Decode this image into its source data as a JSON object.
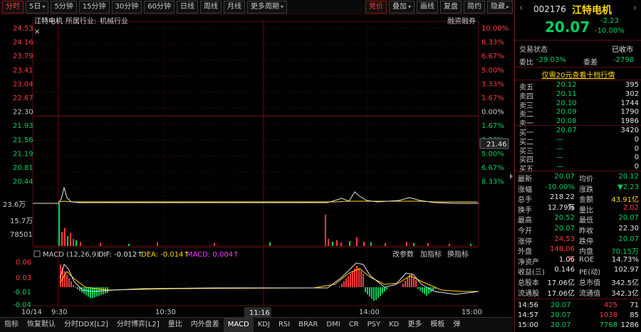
{
  "toolbar": {
    "periods": [
      "分时",
      "5日",
      "5分钟",
      "15分钟",
      "30分钟",
      "60分钟",
      "日线",
      "周线",
      "月线",
      "更多周期"
    ],
    "right_buttons": [
      "竞价",
      "叠加",
      "画线",
      "复盘",
      "简约",
      "隐藏"
    ],
    "prev_icon": "chevron-left-icon",
    "next_icon": "chevron-right-icon"
  },
  "chart": {
    "stock_label": "江特电机",
    "industry_label": "所属行业:",
    "industry_value": "机械行业",
    "margin_label": "融资融券",
    "price_ticks": [
      "24.53",
      "24.16",
      "23.79",
      "23.41",
      "23.04",
      "22.67",
      "22.30",
      "21.93",
      "21.56",
      "21.19",
      "20.81",
      "20.44"
    ],
    "pct_ticks": [
      "10.00%",
      "8.33%",
      "6.67%",
      "5.00%",
      "3.33%",
      "1.67%",
      "0.00%",
      "1.67%",
      "3.33%",
      "5.00%",
      "6.67%",
      "8.33%"
    ],
    "current_tag": "21.46",
    "vol_ticks": [
      "23.6万",
      "15.7万",
      "78501"
    ],
    "macd_title": "MACD (12,26,9)",
    "dif": "DIF: -0.012↑",
    "dea": "DEA: -0.014↑",
    "macd": "MACD: 0.004↑",
    "macd_buttons": [
      "改参数",
      "加指标",
      "换指标"
    ],
    "macd_ticks": [
      "0.06",
      "0.03",
      "-0.01",
      "-0.04"
    ],
    "time_ticks": [
      "10/14",
      "9:30",
      "10:30",
      "11:16",
      "14:00",
      "15:00"
    ],
    "colors": {
      "up": "#ff3b3b",
      "down": "#00d060",
      "price_line": "#e6e6e6",
      "avg_line": "#ffd700",
      "dea_line": "#ffd700"
    }
  },
  "tabs": [
    "指标",
    "恢复默认",
    "分时DDX[L2]",
    "分时博弈[L2]",
    "量比",
    "内外盘差",
    "MACD",
    "KDJ",
    "RSI",
    "BRAR",
    "DMI",
    "CR",
    "PSY",
    "KD",
    "更多",
    "模板",
    "弹"
  ],
  "panel": {
    "code": "002176",
    "name": "江特电机",
    "price": "20.07",
    "change": "-2.23",
    "change_pct": "-10.00%",
    "status_label": "交易状态",
    "status_value": "已收市",
    "weibi_label": "委比",
    "weibi_value": "-29.03%",
    "weicha_label": "委差",
    "weicha_value": "-2798",
    "promo": "仅需20元查看十档行情",
    "asks": [
      {
        "label": "卖五",
        "price": "20.12",
        "vol": "395"
      },
      {
        "label": "卖四",
        "price": "20.11",
        "vol": "302"
      },
      {
        "label": "卖三",
        "price": "20.10",
        "vol": "1744"
      },
      {
        "label": "卖二",
        "price": "20.09",
        "vol": "1790"
      },
      {
        "label": "卖一",
        "price": "20.08",
        "vol": "1986"
      }
    ],
    "bids": [
      {
        "label": "买一",
        "price": "20.07",
        "vol": "3420"
      },
      {
        "label": "买二",
        "price": "—",
        "vol": "0"
      },
      {
        "label": "买三",
        "price": "—",
        "vol": "0"
      },
      {
        "label": "买四",
        "price": "—",
        "vol": "0"
      },
      {
        "label": "买五",
        "price": "—",
        "vol": "0"
      }
    ],
    "stats": [
      {
        "l1": "最新",
        "v1": "20.07",
        "c1": "green",
        "l2": "均价",
        "v2": "20.12",
        "c2": "green"
      },
      {
        "l1": "涨幅",
        "v1": "-10.00%",
        "c1": "green",
        "l2": "涨跌",
        "v2": "▼2.23",
        "c2": "green"
      },
      {
        "l1": "总手",
        "v1": "218.22万",
        "c1": "white",
        "l2": "金额",
        "v2": "43.91亿",
        "c2": "yellow"
      },
      {
        "l1": "换手",
        "v1": "12.79%",
        "c1": "white",
        "l2": "量比",
        "v2": "2.02",
        "c2": "red"
      },
      {
        "l1": "最高",
        "v1": "20.52",
        "c1": "green",
        "l2": "最低",
        "v2": "20.07",
        "c2": "green"
      },
      {
        "l1": "今开",
        "v1": "20.07",
        "c1": "green",
        "l2": "昨收",
        "v2": "22.30",
        "c2": "white"
      },
      {
        "l1": "涨停",
        "v1": "24.53",
        "c1": "red",
        "l2": "跌停",
        "v2": "20.07",
        "c2": "green"
      },
      {
        "l1": "外盘",
        "v1": "148.06万",
        "c1": "red",
        "l2": "内盘",
        "v2": "70.15万",
        "c2": "green"
      },
      {
        "l1": "净资产",
        "v1": "1.06",
        "c1": "white",
        "l2": "ROE",
        "v2": "14.73%",
        "c2": "white"
      },
      {
        "l1": "收益(三)",
        "v1": "0.146",
        "c1": "white",
        "l2": "PE(动)",
        "v2": "102.97",
        "c2": "white"
      },
      {
        "l1": "总股本",
        "v1": "17.06亿",
        "c1": "white",
        "l2": "总市值",
        "v2": "342.5亿",
        "c2": "white"
      },
      {
        "l1": "流通股",
        "v1": "17.06亿",
        "c1": "white",
        "l2": "流通值",
        "v2": "342.3亿",
        "c2": "white"
      }
    ],
    "ticks": [
      {
        "time": "14:56",
        "price": "20.07",
        "vol": "425",
        "n": "71"
      },
      {
        "time": "14:57",
        "price": "20.07",
        "vol": "1038",
        "n": "85"
      },
      {
        "time": "15:00",
        "price": "20.07",
        "vol": "7768",
        "n": "1286"
      }
    ]
  }
}
